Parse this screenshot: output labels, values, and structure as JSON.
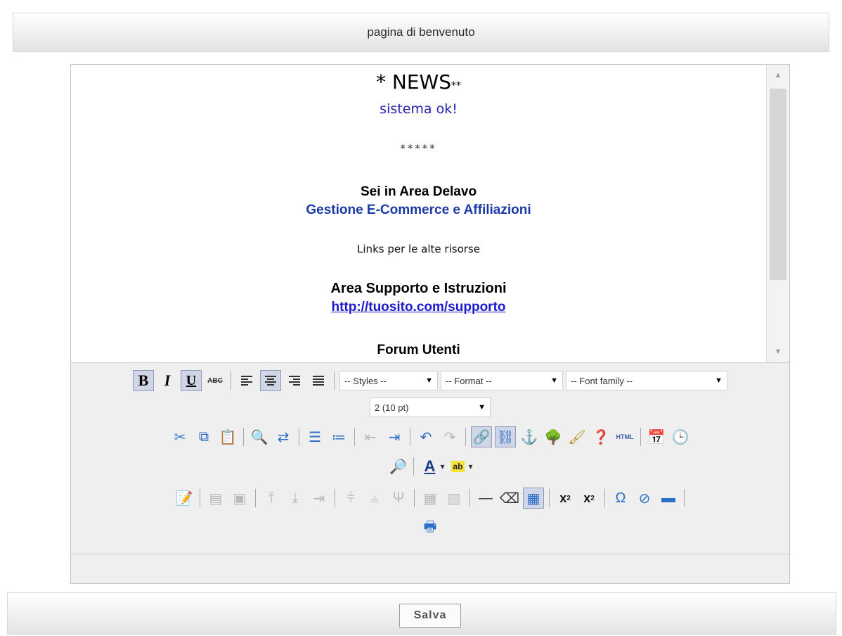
{
  "header": {
    "title": "pagina di benvenuto"
  },
  "content": {
    "news_main": "* NEWS",
    "news_suffix": "**",
    "status_line": "sistema ok!",
    "stars": "*****",
    "area_title": "Sei in Area Delavo",
    "area_subtitle": "Gestione E-Commerce e Affiliazioni",
    "links_line": "Links per le alte risorse",
    "support_title": "Area Supporto e Istruzioni",
    "support_url": "http://tuosito.com/supporto",
    "forum_title": "Forum Utenti"
  },
  "toolbar": {
    "bold": "B",
    "italic": "I",
    "underline": "U",
    "strikethrough": "ABC",
    "styles_select": "-- Styles --",
    "format_select": "-- Format --",
    "font_family_select": "-- Font family --",
    "font_size_select": "2 (10 pt)",
    "html_button": "HTML"
  },
  "footer": {
    "save_label": "Salva"
  }
}
